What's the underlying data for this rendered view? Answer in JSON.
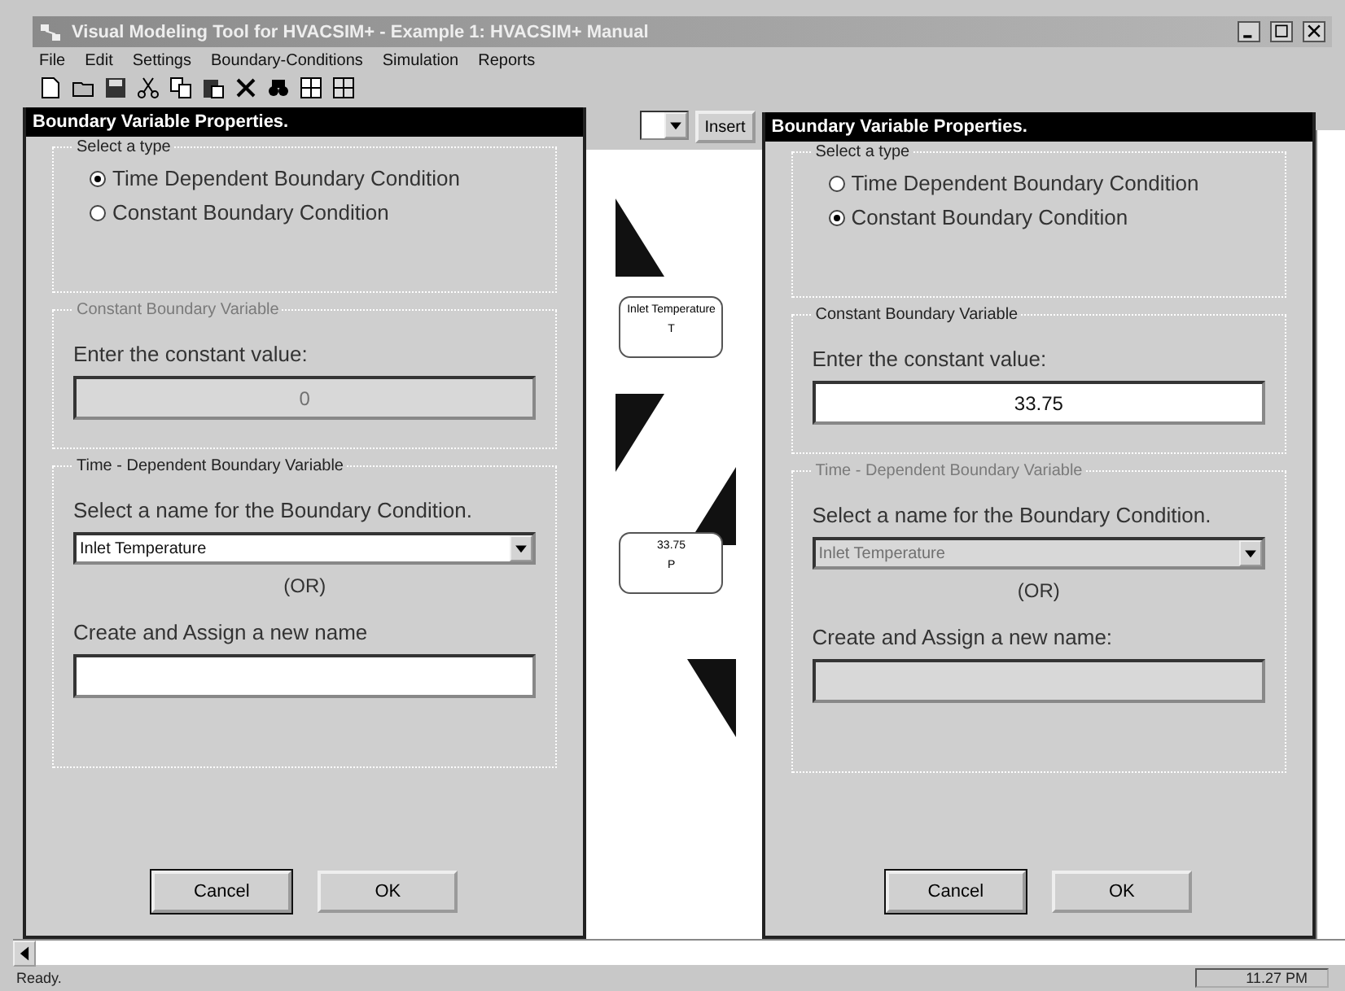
{
  "window": {
    "title": "Visual Modeling Tool for HVACSIM+ - Example 1: HVACSIM+ Manual"
  },
  "menu": [
    {
      "label": "File"
    },
    {
      "label": "Edit"
    },
    {
      "label": "Settings"
    },
    {
      "label": "Boundary-Conditions"
    },
    {
      "label": "Simulation"
    },
    {
      "label": "Reports"
    }
  ],
  "palette": {
    "insert_button": "Insert"
  },
  "canvas": {
    "nodes": [
      {
        "label": "Inlet Temperature",
        "port": "T"
      },
      {
        "label": "33.75",
        "port": "P"
      }
    ]
  },
  "dialogs": [
    {
      "title": "Boundary Variable Properties.",
      "type_group": {
        "label": "Select a type",
        "options": [
          {
            "label": "Time Dependent Boundary Condition",
            "selected": true
          },
          {
            "label": "Constant Boundary Condition",
            "selected": false
          }
        ]
      },
      "constant_group": {
        "label": "Constant Boundary Variable",
        "disabled": true,
        "prompt": "Enter the constant value:",
        "value": "0"
      },
      "time_group": {
        "label": "Time - Dependent Boundary Variable",
        "disabled": false,
        "prompt": "Select a name for the Boundary Condition.",
        "selection": "Inlet Temperature",
        "or_text": "(OR)",
        "new_name_prompt": "Create and Assign a new name"
      },
      "buttons": [
        {
          "label": "Cancel",
          "focused": true
        },
        {
          "label": "OK",
          "focused": false
        }
      ]
    },
    {
      "title": "Boundary Variable Properties.",
      "type_group": {
        "label": "Select a type",
        "options": [
          {
            "label": "Time Dependent Boundary Condition",
            "selected": false
          },
          {
            "label": "Constant Boundary Condition",
            "selected": true
          }
        ]
      },
      "constant_group": {
        "label": "Constant Boundary Variable",
        "disabled": false,
        "prompt": "Enter the constant value:",
        "value": "33.75"
      },
      "time_group": {
        "label": "Time - Dependent Boundary Variable",
        "disabled": true,
        "prompt": "Select a name for the Boundary Condition.",
        "selection": "Inlet Temperature",
        "or_text": "(OR)",
        "new_name_prompt": "Create and Assign a new name:"
      },
      "buttons": [
        {
          "label": "Cancel",
          "focused": true
        },
        {
          "label": "OK",
          "focused": false
        }
      ]
    }
  ],
  "status_bar": {
    "text": "Ready.",
    "time": "11.27 PM"
  }
}
